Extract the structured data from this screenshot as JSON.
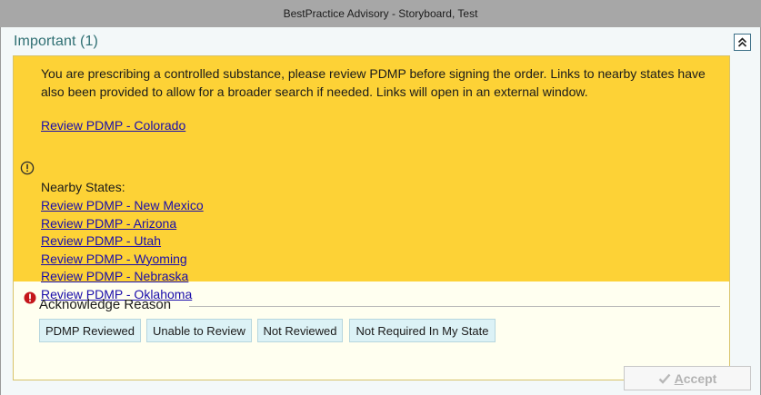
{
  "window": {
    "title": "BestPractice Advisory - Storyboard, Test"
  },
  "section": {
    "title": "Important (1)"
  },
  "alert": {
    "message": "You are prescribing a controlled substance, please review PDMP before signing the order.  Links to nearby states have also been provided to allow for a broader search if needed.  Links will open in an external window.",
    "primary_link": "Review PDMP - Colorado",
    "nearby_label": "Nearby States:",
    "nearby_links": [
      "Review PDMP - New Mexico",
      "Review PDMP - Arizona",
      "Review PDMP - Utah",
      "Review PDMP - Wyoming",
      "Review PDMP - Nebraska",
      "Review PDMP - Oklahoma"
    ]
  },
  "acknowledge": {
    "title": "Acknowledge Reason",
    "reasons": [
      "PDMP Reviewed",
      "Unable to Review",
      "Not Reviewed",
      "Not Required In My State"
    ]
  },
  "footer": {
    "accept_prefix": "A",
    "accept_rest": "ccept"
  },
  "colors": {
    "alert_yellow": "#fdd236",
    "link": "#1a0dab",
    "title_teal": "#2f6f73",
    "reason_button_bg": "#dcf2f6",
    "error_red": "#c4161c"
  },
  "icons": {
    "collapse": "double-chevron-up-icon",
    "warning": "exclamation-circle-icon",
    "required": "red-exclamation-icon",
    "accept": "checkmark-icon"
  }
}
